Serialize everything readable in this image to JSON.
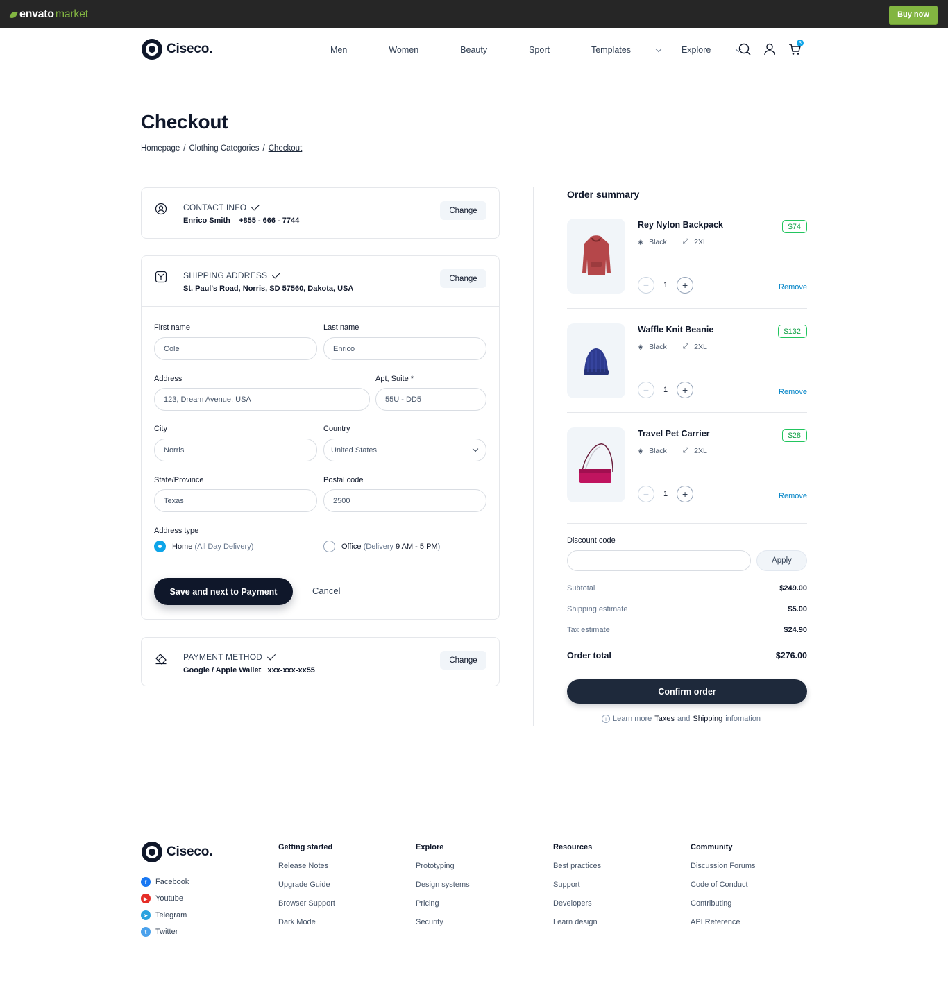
{
  "topbar": {
    "logo_main": "envato",
    "logo_sub": "market",
    "buy_now": "Buy now"
  },
  "header": {
    "brand": "Ciseco.",
    "nav": [
      "Men",
      "Women",
      "Beauty",
      "Sport",
      "Templates",
      "Explore"
    ],
    "cart_count": "3"
  },
  "page": {
    "title": "Checkout",
    "breadcrumb": [
      "Homepage",
      "/",
      "Clothing Categories",
      "/",
      "Checkout"
    ]
  },
  "contact": {
    "label": "CONTACT INFO",
    "name": "Enrico Smith",
    "phone": "+855 - 666 - 7744",
    "change": "Change"
  },
  "shipping": {
    "label": "SHIPPING ADDRESS",
    "address": "St. Paul's Road, Norris, SD 57560, Dakota, USA",
    "change": "Change",
    "form": {
      "first_name_label": "First name",
      "first_name": "Cole",
      "last_name_label": "Last name",
      "last_name": "Enrico",
      "address_label": "Address",
      "address": "123, Dream Avenue, USA",
      "apt_label": "Apt, Suite *",
      "apt": "55U - DD5",
      "city_label": "City",
      "city": "Norris",
      "country_label": "Country",
      "country": "United States",
      "state_label": "State/Province",
      "state": "Texas",
      "postal_label": "Postal code",
      "postal": "2500",
      "address_type_label": "Address type",
      "home_label": "Home",
      "home_note": "(All Day Delivery)",
      "office_label": "Office",
      "office_note_a": "(Delivery",
      "office_note_b": "9 AM - 5 PM",
      "office_note_c": ")",
      "selected": "home",
      "save_button": "Save and next to Payment",
      "cancel_button": "Cancel"
    }
  },
  "payment": {
    "label": "PAYMENT METHOD",
    "method": "Google / Apple Wallet",
    "number": "xxx-xxx-xx55",
    "change": "Change"
  },
  "summary": {
    "title": "Order summary",
    "items": [
      {
        "name": "Rey Nylon Backpack",
        "color": "Black",
        "size": "2XL",
        "price": "$74",
        "qty": "1",
        "remove": "Remove"
      },
      {
        "name": "Waffle Knit Beanie",
        "color": "Black",
        "size": "2XL",
        "price": "$132",
        "qty": "1",
        "remove": "Remove"
      },
      {
        "name": "Travel Pet Carrier",
        "color": "Black",
        "size": "2XL",
        "price": "$28",
        "qty": "1",
        "remove": "Remove"
      }
    ],
    "discount_label": "Discount code",
    "apply": "Apply",
    "subtotal_label": "Subtotal",
    "subtotal": "$249.00",
    "shipping_label": "Shipping estimate",
    "shipping": "$5.00",
    "tax_label": "Tax estimate",
    "tax": "$24.90",
    "total_label": "Order total",
    "total": "$276.00",
    "confirm": "Confirm order",
    "learn_a": "Learn more",
    "learn_taxes": "Taxes",
    "learn_and": "and",
    "learn_shipping": "Shipping",
    "learn_b": "infomation"
  },
  "footer": {
    "brand": "Ciseco.",
    "social": [
      "Facebook",
      "Youtube",
      "Telegram",
      "Twitter"
    ],
    "columns": [
      {
        "title": "Getting started",
        "links": [
          "Release Notes",
          "Upgrade Guide",
          "Browser Support",
          "Dark Mode"
        ]
      },
      {
        "title": "Explore",
        "links": [
          "Prototyping",
          "Design systems",
          "Pricing",
          "Security"
        ]
      },
      {
        "title": "Resources",
        "links": [
          "Best practices",
          "Support",
          "Developers",
          "Learn design"
        ]
      },
      {
        "title": "Community",
        "links": [
          "Discussion Forums",
          "Code of Conduct",
          "Contributing",
          "API Reference"
        ]
      }
    ]
  },
  "colors": {
    "accent": "#0ea5e9",
    "dark": "#0f172a",
    "price_green": "#22c55e",
    "envato_green": "#82b541"
  }
}
